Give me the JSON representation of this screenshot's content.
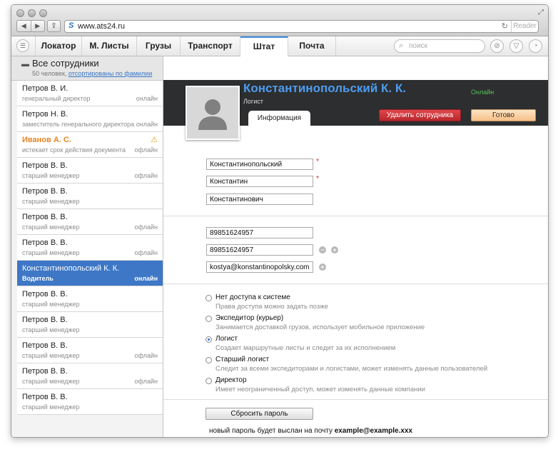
{
  "browser": {
    "url": "www.ats24.ru",
    "reader_label": "Reader"
  },
  "appnav": {
    "tabs": [
      {
        "label": "Локатор"
      },
      {
        "label": "М. Листы"
      },
      {
        "label": "Грузы"
      },
      {
        "label": "Транспорт"
      },
      {
        "label": "Штат"
      },
      {
        "label": "Почта"
      }
    ],
    "active_tab": "Штат",
    "search_placeholder": "поиск"
  },
  "sidebar": {
    "title": "Все сотрудники",
    "count_text": "50 человек, ",
    "sort_link": "отсортированы по фамилии",
    "items": [
      {
        "name": "Петров В. И.",
        "role": "генеральный директор",
        "status": "онлайн"
      },
      {
        "name": "Петров Н. В.",
        "role": "заместитель генерального директора",
        "status": "онлайн"
      },
      {
        "name": "Иванов А. С.",
        "role": "истекает срок действия документа",
        "status": "офлайн"
      },
      {
        "name": "Петров В. В.",
        "role": "старший менеджер",
        "status": "офлайн"
      },
      {
        "name": "Петров В. В.",
        "role": "старший менеджер",
        "status": ""
      },
      {
        "name": "Петров В. В.",
        "role": "старший менеджер",
        "status": "офлайн"
      },
      {
        "name": "Петров В. В.",
        "role": "старший менеджер",
        "status": "офлайн"
      },
      {
        "name": "Константинопольский К. К.",
        "role": "Водитель",
        "status": "онлайн"
      },
      {
        "name": "Петров В. В.",
        "role": "старший менеджер",
        "status": ""
      },
      {
        "name": "Петров В. В.",
        "role": "старший менеджер",
        "status": ""
      },
      {
        "name": "Петров В. В.",
        "role": "старший менеджер",
        "status": "офлайн"
      },
      {
        "name": "Петров В. В.",
        "role": "старший менеджер",
        "status": "офлайн"
      },
      {
        "name": "Петров В. В.",
        "role": "старший менеджер",
        "status": ""
      }
    ]
  },
  "profile": {
    "name": "Константинопольский К. К.",
    "role": "Логист",
    "online": "Онлайн",
    "tab_info": "Информация",
    "delete_label": "Удалить сотрудника",
    "done_label": "Готово",
    "last_name": "Константинопольский",
    "first_name": "Константин",
    "patronymic": "Константинович",
    "phone1": "89851624957",
    "phone2": "89851624957",
    "email": "kostya@konstantinopolsky.com",
    "required_mark": "*"
  },
  "access": {
    "options": [
      {
        "title": "Нет доступа к системе",
        "desc": "Права доступа можно задать позже"
      },
      {
        "title": "Экспедитор (курьер)",
        "desc": "Занимается доставкой грузов, использует мобильное приложение"
      },
      {
        "title": "Логист",
        "desc": "Создает маршрутные листы и следит за их исполнением"
      },
      {
        "title": "Старший логист",
        "desc": "Следит за всеми экспедиторами и логистами, может изменять данные пользователей"
      },
      {
        "title": "Директор",
        "desc": "Имеет неограниченный доступ, может изменять данные компании"
      }
    ],
    "selected": "Логист"
  },
  "reset": {
    "button_label": "Сбросить пароль",
    "note_prefix": "новый пароль будет выслан на почту",
    "note_email": "example@example.xxx"
  },
  "icons": [
    "menu-icon",
    "search-icon",
    "attachment-icon",
    "filter-icon",
    "speed-icon",
    "folder-icon",
    "warning-icon",
    "avatar-icon",
    "remove-icon",
    "add-icon"
  ],
  "colors": {
    "accent": "#3d77c6",
    "name_blue": "#4d9cf0",
    "online_green": "#55c35a",
    "warning_orange": "#e68424",
    "danger_red": "#c9353a"
  }
}
